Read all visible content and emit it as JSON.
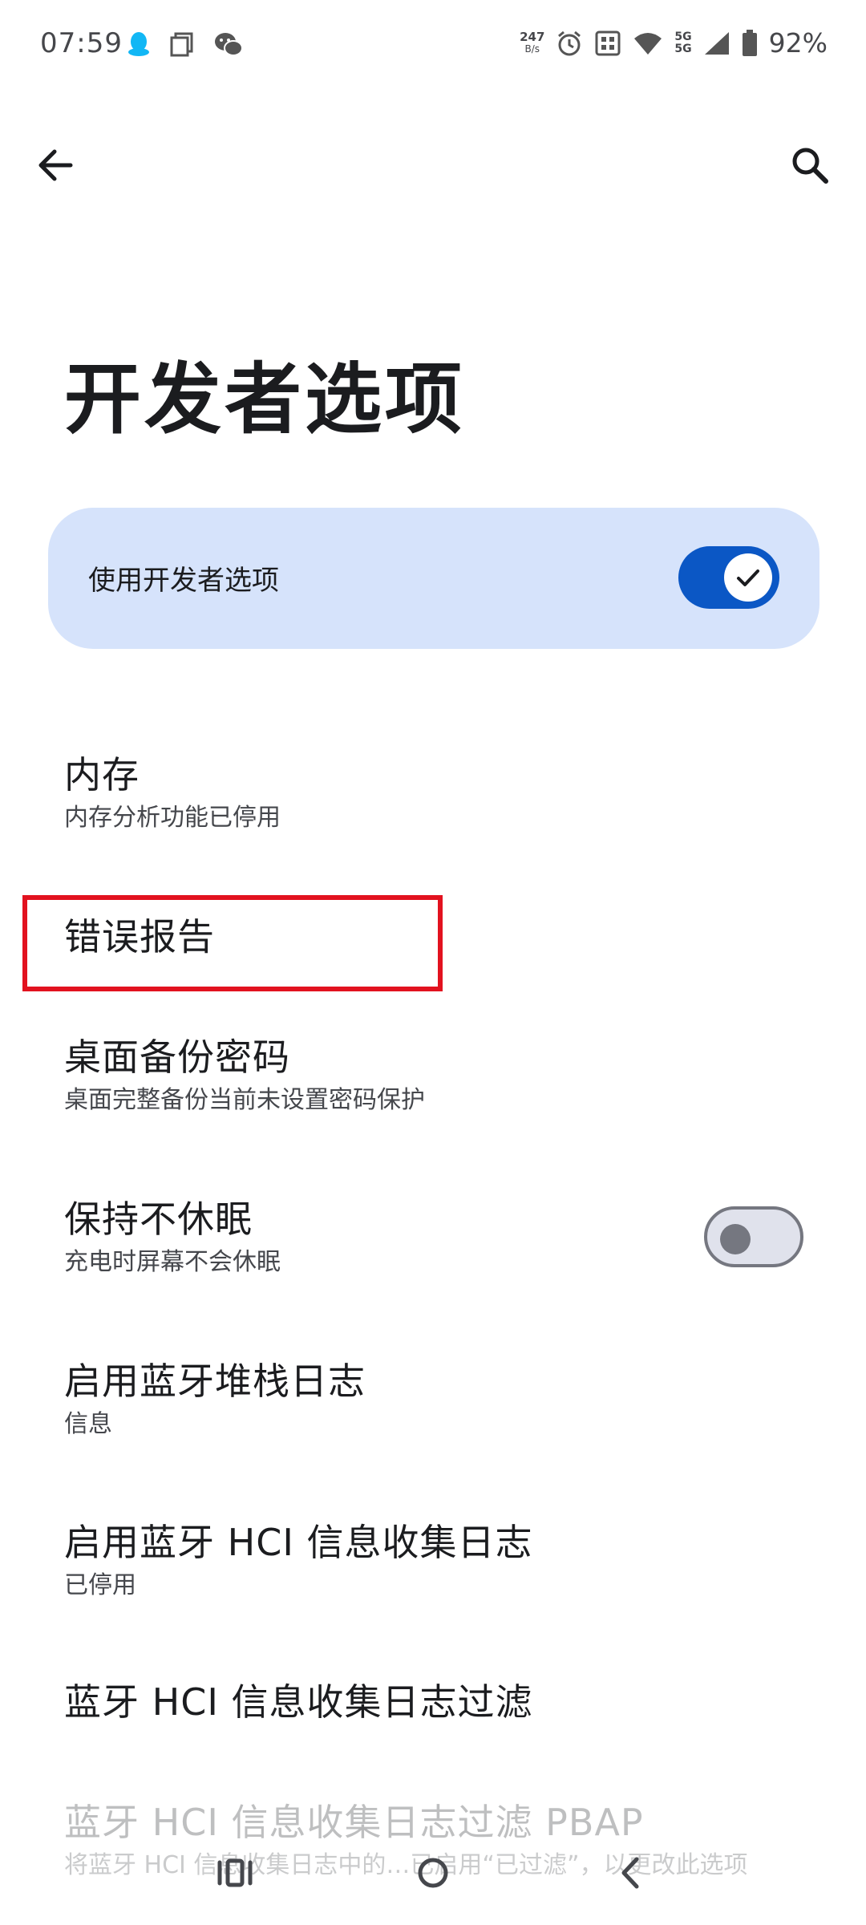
{
  "status_bar": {
    "time": "07:59",
    "net_speed_value": "247",
    "net_speed_unit": "B/s",
    "network_label_1": "5G",
    "network_label_2": "5G",
    "battery_percent": "92%",
    "left_icons": [
      "qq-icon",
      "screenshot-icon",
      "wechat-icon"
    ],
    "right_icons": [
      "alarm-icon",
      "nfc-icon",
      "wifi-icon",
      "signal-icon",
      "battery-icon"
    ]
  },
  "app_bar": {
    "back_icon": "arrow-left-icon",
    "search_icon": "search-icon"
  },
  "page": {
    "title": "开发者选项"
  },
  "master_toggle": {
    "label": "使用开发者选项",
    "state": "on",
    "accent_color": "#0b57c5",
    "card_color": "#d6e3fb"
  },
  "items": [
    {
      "title": "内存",
      "subtitle": "内存分析功能已停用"
    },
    {
      "title": "错误报告"
    },
    {
      "title": "桌面备份密码",
      "subtitle": "桌面完整备份当前未设置密码保护"
    },
    {
      "title": "保持不休眠",
      "subtitle": "充电时屏幕不会休眠",
      "toggle": "off"
    },
    {
      "title": "启用蓝牙堆栈日志",
      "subtitle": "信息"
    },
    {
      "title": "启用蓝牙 HCI 信息收集日志",
      "subtitle": "已停用"
    },
    {
      "title": "蓝牙 HCI 信息收集日志过滤"
    },
    {
      "title": "蓝牙 HCI 信息收集日志过滤 PBAP",
      "subtitle": "将蓝牙 HCI 信息收集日志中的…已启用“已过滤”，以更改此选项"
    }
  ],
  "highlight_color": "#e2121f",
  "nav_bar": {
    "recents_icon": "recents-icon",
    "home_icon": "home-icon",
    "back_icon": "nav-back-icon"
  }
}
